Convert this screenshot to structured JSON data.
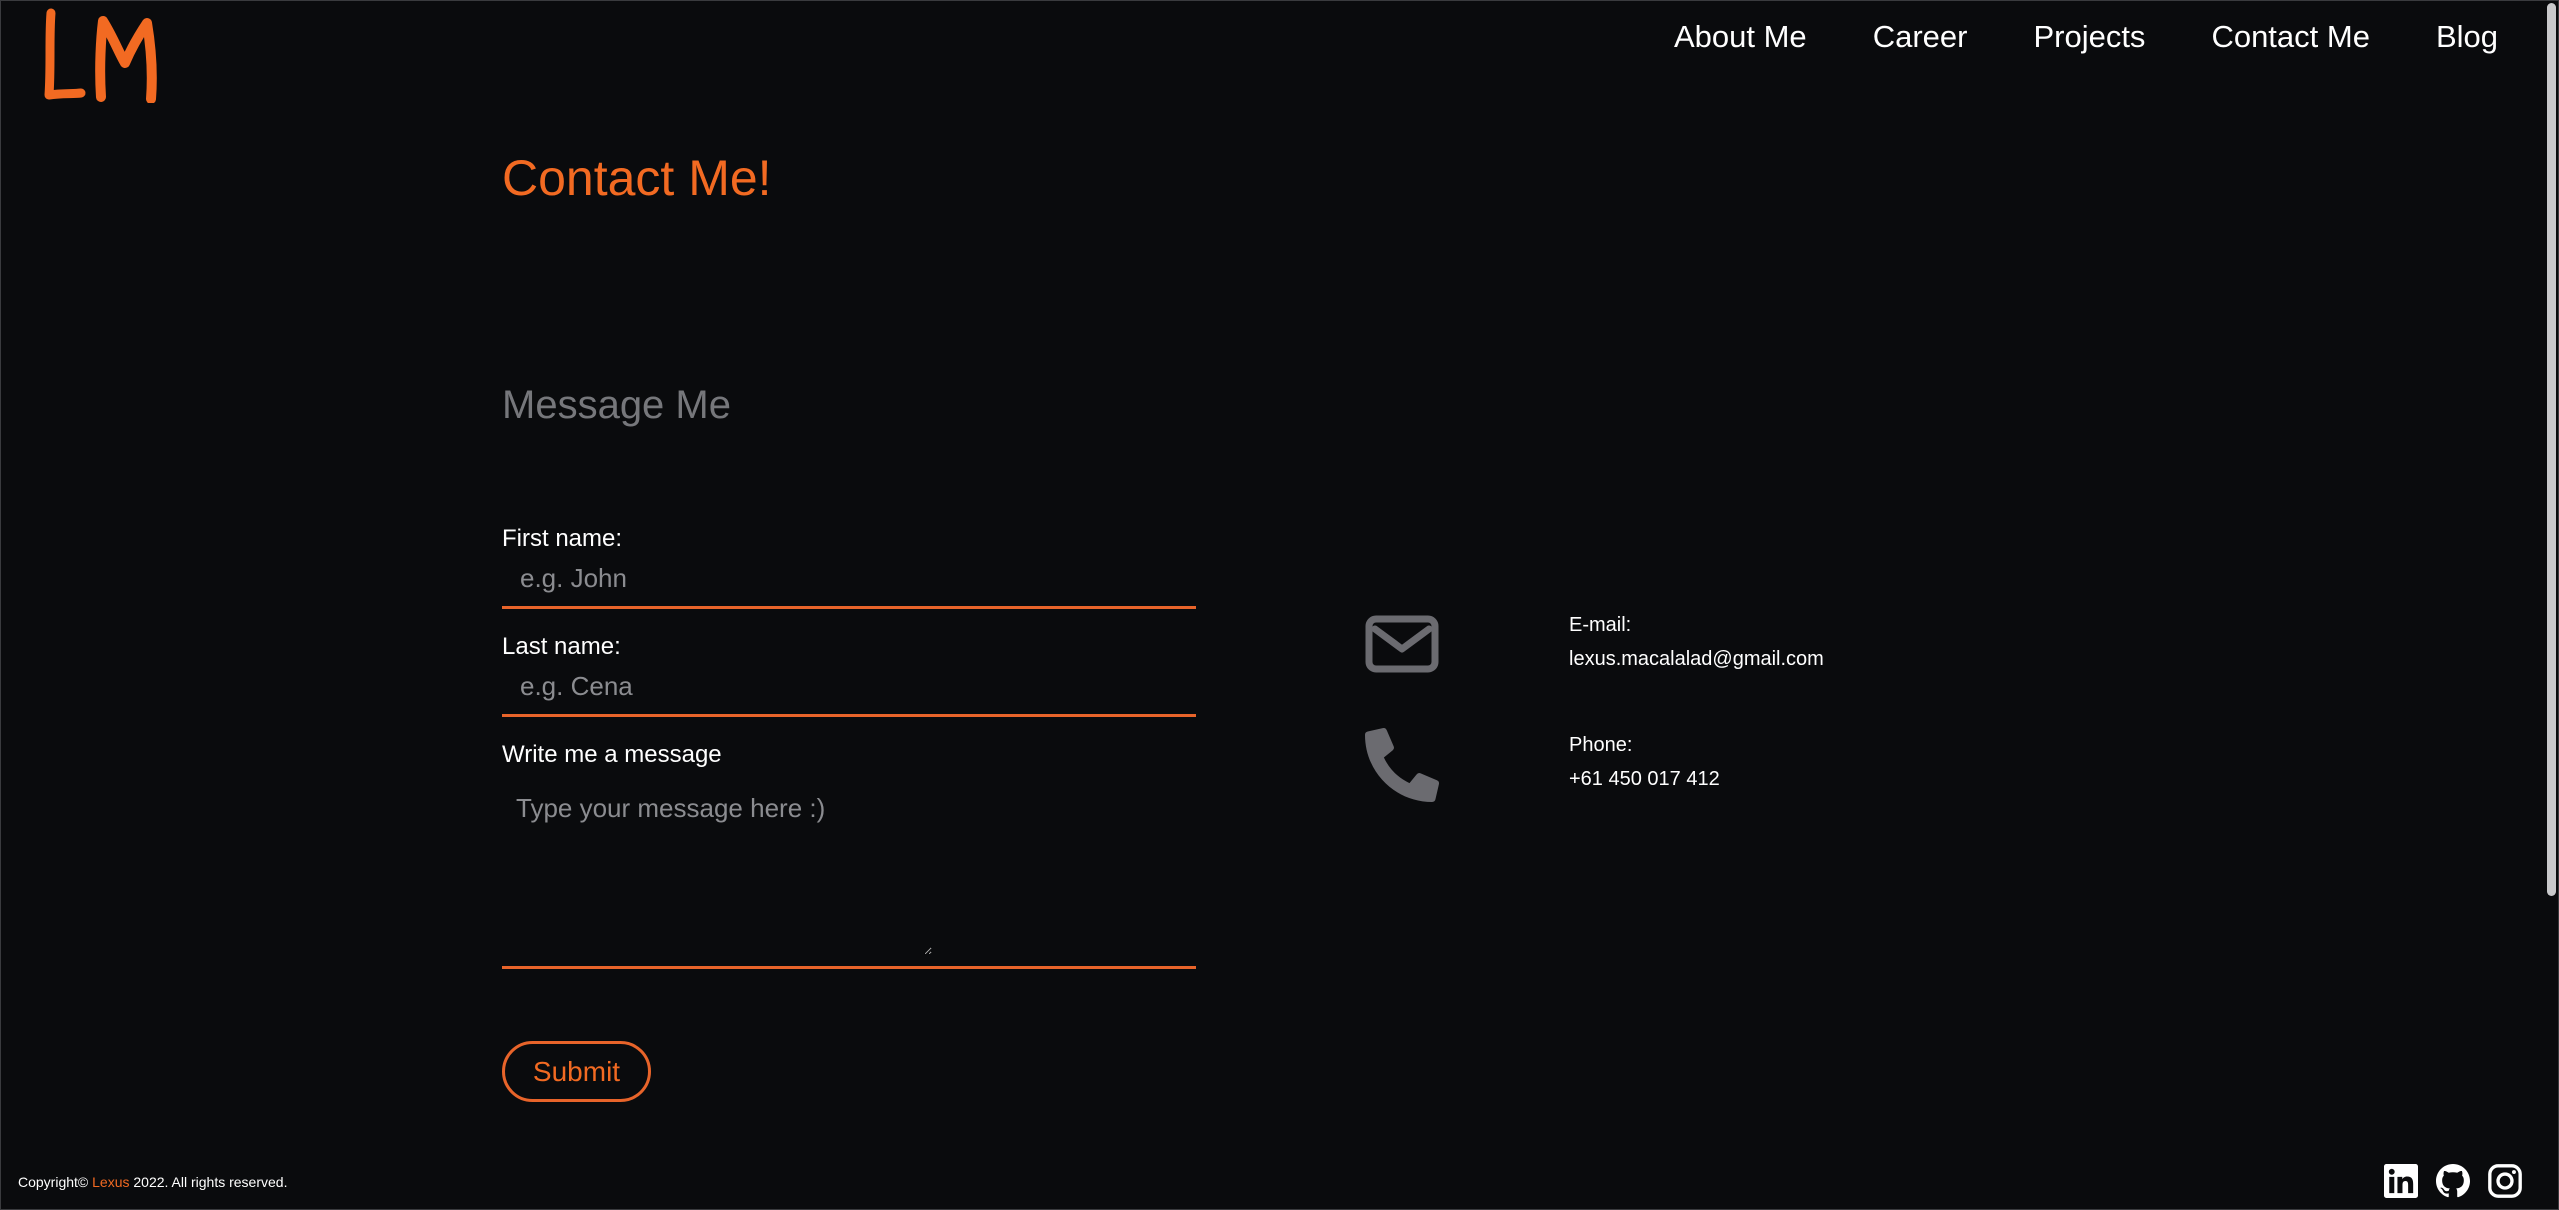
{
  "header": {
    "logo_text": "LM",
    "nav": [
      {
        "label": "About Me"
      },
      {
        "label": "Career"
      },
      {
        "label": "Projects"
      },
      {
        "label": "Contact Me"
      },
      {
        "label": "Blog"
      }
    ]
  },
  "main": {
    "title": "Contact Me!",
    "form_title": "Message Me",
    "first_name": {
      "label": "First name:",
      "placeholder": "e.g. John"
    },
    "last_name": {
      "label": "Last name:",
      "placeholder": "e.g. Cena"
    },
    "message": {
      "label": "Write me a message",
      "placeholder": "Type your message here :)"
    },
    "submit_label": "Submit"
  },
  "contact": {
    "email": {
      "label": "E-mail:",
      "value": "lexus.macalalad@gmail.com",
      "icon": "envelope-icon"
    },
    "phone": {
      "label": "Phone:",
      "value": "+61 450 017 412",
      "icon": "phone-icon"
    }
  },
  "footer": {
    "copyright_prefix": "Copyright© ",
    "brand": "Lexus",
    "copyright_suffix": " 2022. All rights reserved.",
    "socials": [
      "linkedin-icon",
      "github-icon",
      "instagram-icon"
    ]
  },
  "colors": {
    "accent": "#f26a22",
    "background": "#0a0b0d",
    "muted": "#76777b",
    "icon_gray": "#6b6b70"
  }
}
